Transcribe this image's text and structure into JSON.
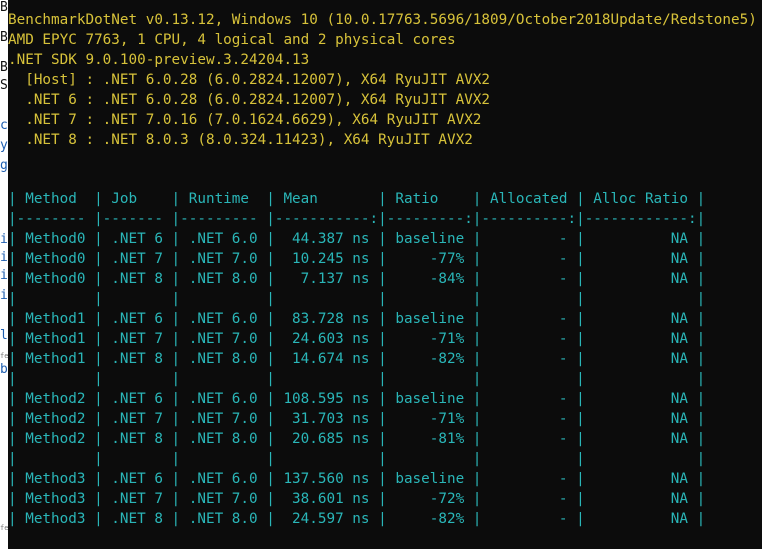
{
  "header": {
    "lines": [
      "BenchmarkDotNet v0.13.12, Windows 10 (10.0.17763.5696/1809/October2018Update/Redstone5)",
      "AMD EPYC 7763, 1 CPU, 4 logical and 2 physical cores",
      ".NET SDK 9.0.100-preview.3.24204.13",
      "  [Host] : .NET 6.0.28 (6.0.2824.12007), X64 RyuJIT AVX2",
      "  .NET 6 : .NET 6.0.28 (6.0.2824.12007), X64 RyuJIT AVX2",
      "  .NET 7 : .NET 7.0.16 (7.0.1624.6629), X64 RyuJIT AVX2",
      "  .NET 8 : .NET 8.0.3 (8.0.324.11423), X64 RyuJIT AVX2"
    ]
  },
  "table": {
    "lines": [
      "| Method  | Job    | Runtime  | Mean       | Ratio    | Allocated | Alloc Ratio |",
      "|-------- |------- |--------- |-----------:|---------:|----------:|------------:|",
      "| Method0 | .NET 6 | .NET 6.0 |  44.387 ns | baseline |         - |          NA |",
      "| Method0 | .NET 7 | .NET 7.0 |  10.245 ns |     -77% |         - |          NA |",
      "| Method0 | .NET 8 | .NET 8.0 |   7.137 ns |     -84% |         - |          NA |",
      "|         |        |          |            |          |           |             |",
      "| Method1 | .NET 6 | .NET 6.0 |  83.728 ns | baseline |         - |          NA |",
      "| Method1 | .NET 7 | .NET 7.0 |  24.603 ns |     -71% |         - |          NA |",
      "| Method1 | .NET 8 | .NET 8.0 |  14.674 ns |     -82% |         - |          NA |",
      "|         |        |          |            |          |           |             |",
      "| Method2 | .NET 6 | .NET 6.0 | 108.595 ns | baseline |         - |          NA |",
      "| Method2 | .NET 7 | .NET 7.0 |  31.703 ns |     -71% |         - |          NA |",
      "| Method2 | .NET 8 | .NET 8.0 |  20.685 ns |     -81% |         - |          NA |",
      "|         |        |          |            |          |           |             |",
      "| Method3 | .NET 6 | .NET 6.0 | 137.560 ns | baseline |         - |          NA |",
      "| Method3 | .NET 7 | .NET 7.0 |  38.601 ns |     -72% |         - |          NA |",
      "| Method3 | .NET 8 | .NET 8.0 |  24.597 ns |     -82% |         - |          NA |"
    ]
  },
  "background_fragments": [
    "B",
    "B",
    "B",
    "S",
    "c",
    "y",
    "g",
    "i",
    "i",
    "i",
    "i",
    "l",
    "b",
    "fe",
    "fe"
  ],
  "colors": {
    "console_bg": "#0c0c0c",
    "header_text": "#d7c23a",
    "table_text": "#2ab6b8"
  }
}
